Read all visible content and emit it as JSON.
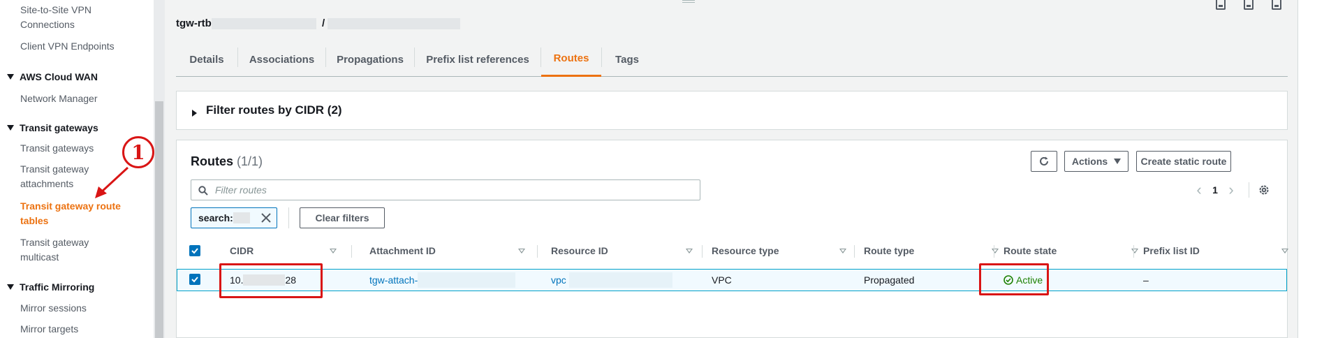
{
  "sidebar": {
    "items": [
      {
        "label": "Site-to-Site VPN Connections"
      },
      {
        "label": "Client VPN Endpoints"
      },
      {
        "section": "AWS Cloud WAN"
      },
      {
        "label": "Network Manager"
      },
      {
        "section": "Transit gateways"
      },
      {
        "label": "Transit gateways"
      },
      {
        "label": "Transit gateway attachments"
      },
      {
        "label": "Transit gateway route tables"
      },
      {
        "label": "Transit gateway multicast"
      },
      {
        "section": "Traffic Mirroring"
      },
      {
        "label": "Mirror sessions"
      },
      {
        "label": "Mirror targets"
      }
    ],
    "active_item": "Transit gateway route tables"
  },
  "breadcrumb": {
    "prefix": "tgw-rtb",
    "separator": "/"
  },
  "tabs": [
    {
      "label": "Details"
    },
    {
      "label": "Associations"
    },
    {
      "label": "Propagations"
    },
    {
      "label": "Prefix list references"
    },
    {
      "label": "Routes"
    },
    {
      "label": "Tags"
    }
  ],
  "active_tab": "Routes",
  "filter_panel": {
    "title": "Filter routes by CIDR (2)",
    "expanded": false
  },
  "routes": {
    "title": "Routes",
    "count": "(1/1)",
    "buttons": {
      "refresh_icon": "refresh-icon",
      "actions": "Actions",
      "create": "Create static route"
    },
    "search": {
      "placeholder": "Filter routes",
      "value": ""
    },
    "pagination": {
      "page": "1"
    },
    "filter_token": "search:",
    "clear_filters": "Clear filters",
    "columns": [
      "CIDR",
      "Attachment ID",
      "Resource ID",
      "Resource type",
      "Route type",
      "Route state",
      "Prefix list ID"
    ],
    "rows": [
      {
        "cidr_prefix": "10.",
        "cidr_suffix": "28",
        "attachment_prefix": "tgw-attach-",
        "resource_prefix": "vpc",
        "resource_type": "VPC",
        "route_type": "Propagated",
        "route_state": "Active",
        "prefix_list_id": "–"
      }
    ]
  },
  "annotation": {
    "number": "1"
  },
  "colors": {
    "accent": "#ec7211",
    "link": "#0073bb",
    "active_status": "#1d8102",
    "highlight": "#d91515"
  }
}
